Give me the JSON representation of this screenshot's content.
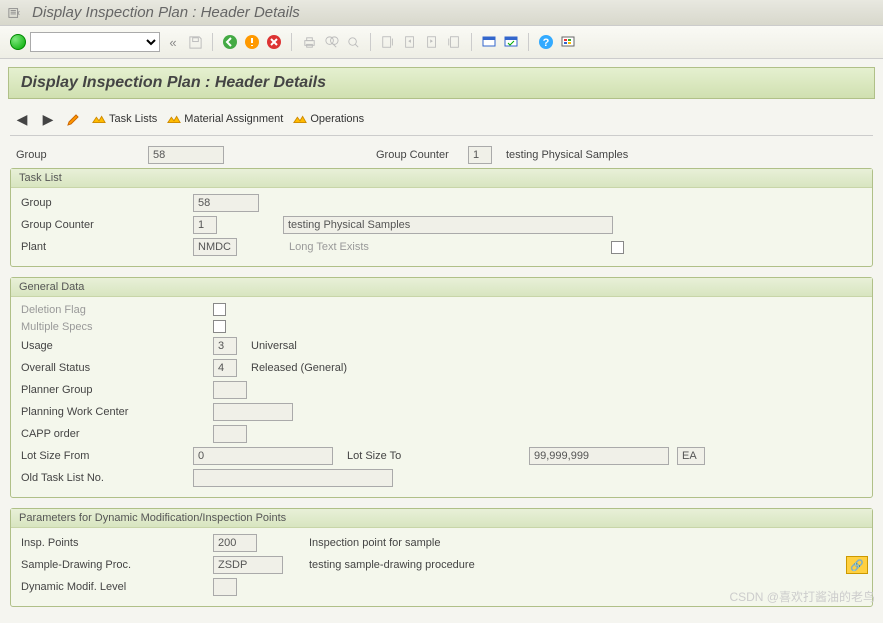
{
  "window": {
    "title": "Display Inspection Plan : Header Details"
  },
  "page": {
    "title": "Display Inspection Plan : Header Details"
  },
  "appToolbar": {
    "taskLists": "Task Lists",
    "materialAssignment": "Material Assignment",
    "operations": "Operations"
  },
  "header": {
    "groupLabel": "Group",
    "group": "58",
    "groupCounterLabel": "Group Counter",
    "groupCounter": "1",
    "desc": "testing Physical Samples"
  },
  "taskList": {
    "title": "Task List",
    "groupLabel": "Group",
    "group": "58",
    "groupCounterLabel": "Group Counter",
    "groupCounter": "1",
    "counterDesc": "testing Physical Samples",
    "plantLabel": "Plant",
    "plant": "NMDC",
    "longTextLabel": "Long Text Exists"
  },
  "generalData": {
    "title": "General Data",
    "deletionFlagLabel": "Deletion Flag",
    "multipleSpecsLabel": "Multiple Specs",
    "usageLabel": "Usage",
    "usage": "3",
    "usageDesc": "Universal",
    "overallStatusLabel": "Overall Status",
    "overallStatus": "4",
    "overallStatusDesc": "Released (General)",
    "plannerGroupLabel": "Planner Group",
    "plannerGroup": "",
    "planningWorkCenterLabel": "Planning Work Center",
    "planningWorkCenter": "",
    "cappOrderLabel": "CAPP order",
    "cappOrder": "",
    "lotSizeFromLabel": "Lot Size From",
    "lotSizeFrom": "0",
    "lotSizeToLabel": "Lot Size To",
    "lotSizeTo": "99,999,999",
    "lotSizeUnit": "EA",
    "oldTaskListNoLabel": "Old Task List No.",
    "oldTaskListNo": ""
  },
  "params": {
    "title": "Parameters for Dynamic Modification/Inspection Points",
    "inspPointsLabel": "Insp. Points",
    "inspPoints": "200",
    "inspPointsDesc": "Inspection point for sample",
    "sampleDrawingProcLabel": "Sample-Drawing Proc.",
    "sampleDrawingProc": "ZSDP",
    "sampleDrawingProcDesc": "testing sample-drawing procedure",
    "dynamicModifLevelLabel": "Dynamic Modif. Level",
    "dynamicModifLevel": ""
  },
  "watermark": "CSDN @喜欢打酱油的老鸟"
}
